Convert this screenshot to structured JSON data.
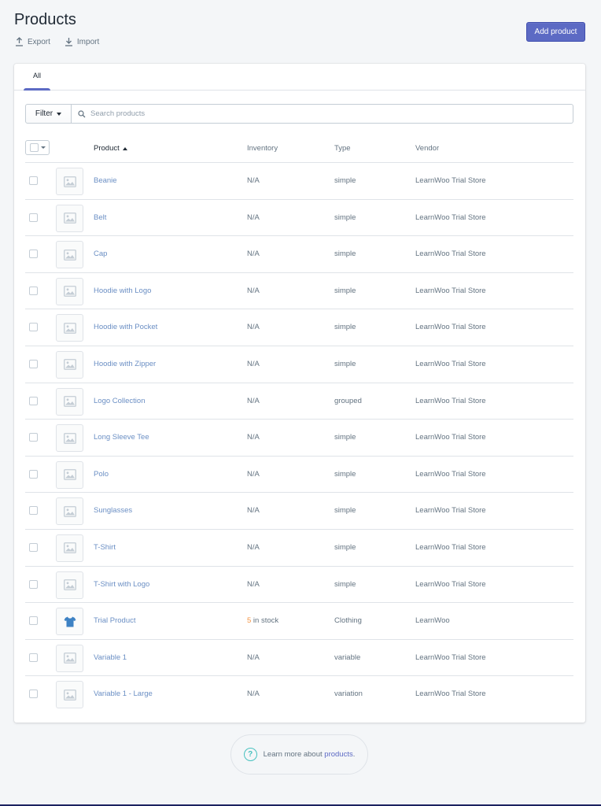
{
  "header": {
    "title": "Products",
    "export_label": "Export",
    "import_label": "Import",
    "add_button": "Add product"
  },
  "tabs": [
    {
      "label": "All",
      "selected": true
    }
  ],
  "filter": {
    "button_label": "Filter",
    "search_placeholder": "Search products"
  },
  "table": {
    "columns": {
      "product": "Product",
      "inventory": "Inventory",
      "type": "Type",
      "vendor": "Vendor"
    },
    "sort": {
      "column": "Product",
      "direction": "ascending"
    },
    "rows": [
      {
        "name": "Beanie",
        "inventory": "N/A",
        "type": "simple",
        "vendor": "LearnWoo Trial Store",
        "thumb": "image-placeholder-icon"
      },
      {
        "name": "Belt",
        "inventory": "N/A",
        "type": "simple",
        "vendor": "LearnWoo Trial Store",
        "thumb": "image-placeholder-icon"
      },
      {
        "name": "Cap",
        "inventory": "N/A",
        "type": "simple",
        "vendor": "LearnWoo Trial Store",
        "thumb": "image-placeholder-icon"
      },
      {
        "name": "Hoodie with Logo",
        "inventory": "N/A",
        "type": "simple",
        "vendor": "LearnWoo Trial Store",
        "thumb": "image-placeholder-icon"
      },
      {
        "name": "Hoodie with Pocket",
        "inventory": "N/A",
        "type": "simple",
        "vendor": "LearnWoo Trial Store",
        "thumb": "image-placeholder-icon"
      },
      {
        "name": "Hoodie with Zipper",
        "inventory": "N/A",
        "type": "simple",
        "vendor": "LearnWoo Trial Store",
        "thumb": "image-placeholder-icon"
      },
      {
        "name": "Logo Collection",
        "inventory": "N/A",
        "type": "grouped",
        "vendor": "LearnWoo Trial Store",
        "thumb": "image-placeholder-icon"
      },
      {
        "name": "Long Sleeve Tee",
        "inventory": "N/A",
        "type": "simple",
        "vendor": "LearnWoo Trial Store",
        "thumb": "image-placeholder-icon"
      },
      {
        "name": "Polo",
        "inventory": "N/A",
        "type": "simple",
        "vendor": "LearnWoo Trial Store",
        "thumb": "image-placeholder-icon"
      },
      {
        "name": "Sunglasses",
        "inventory": "N/A",
        "type": "simple",
        "vendor": "LearnWoo Trial Store",
        "thumb": "image-placeholder-icon"
      },
      {
        "name": "T-Shirt",
        "inventory": "N/A",
        "type": "simple",
        "vendor": "LearnWoo Trial Store",
        "thumb": "image-placeholder-icon"
      },
      {
        "name": "T-Shirt with Logo",
        "inventory": "N/A",
        "type": "simple",
        "vendor": "LearnWoo Trial Store",
        "thumb": "image-placeholder-icon"
      },
      {
        "name": "Trial Product",
        "inventory_qty": "5",
        "inventory_suffix": " in stock",
        "type": "Clothing",
        "vendor": "LearnWoo",
        "thumb": "tshirt-icon"
      },
      {
        "name": "Variable 1",
        "inventory": "N/A",
        "type": "variable",
        "vendor": "LearnWoo Trial Store",
        "thumb": "image-placeholder-icon"
      },
      {
        "name": "Variable 1 - Large",
        "inventory": "N/A",
        "type": "variation",
        "vendor": "LearnWoo Trial Store",
        "thumb": "image-placeholder-icon"
      }
    ]
  },
  "footer": {
    "text": "Learn more about ",
    "link": "products",
    "suffix": "."
  },
  "colors": {
    "accent": "#5c6ac4",
    "link": "#6b8fc4",
    "stock_warning": "#f49342",
    "help_teal": "#47c1bf"
  }
}
